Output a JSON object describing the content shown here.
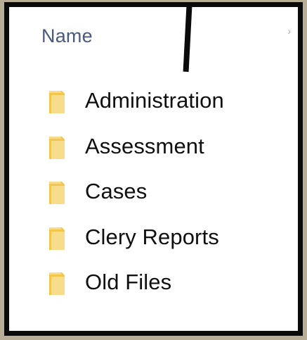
{
  "file_list": {
    "column_header": "Name",
    "items": [
      {
        "name": "Administration",
        "icon": "folder-icon"
      },
      {
        "name": "Assessment",
        "icon": "folder-icon"
      },
      {
        "name": "Cases",
        "icon": "folder-icon"
      },
      {
        "name": "Clery Reports",
        "icon": "folder-icon"
      },
      {
        "name": "Old Files",
        "icon": "folder-icon"
      }
    ]
  },
  "colors": {
    "folder": "#f2c64b",
    "folder_light": "#f7dc8b",
    "header_text": "#4b5a78",
    "frame": "#0a0a0a",
    "background": "#b8ad95"
  }
}
